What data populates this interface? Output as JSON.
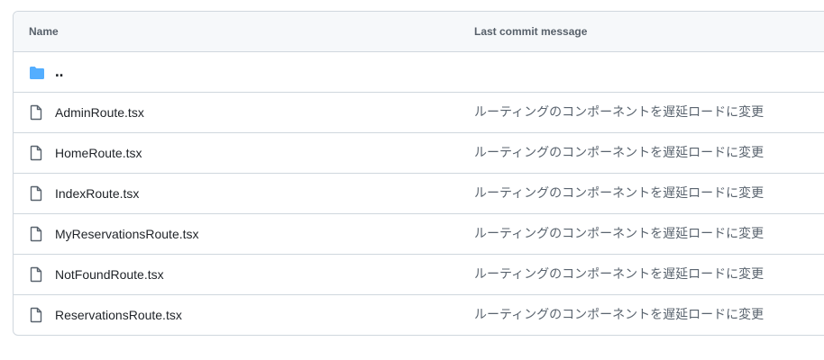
{
  "table": {
    "header": {
      "name_label": "Name",
      "message_label": "Last commit message"
    },
    "parent_dir": {
      "label": "‥",
      "icon": "folder-icon"
    },
    "files": [
      {
        "name": "AdminRoute.tsx",
        "message": "ルーティングのコンポーネントを遅延ロードに変更",
        "icon": "file-icon"
      },
      {
        "name": "HomeRoute.tsx",
        "message": "ルーティングのコンポーネントを遅延ロードに変更",
        "icon": "file-icon"
      },
      {
        "name": "IndexRoute.tsx",
        "message": "ルーティングのコンポーネントを遅延ロードに変更",
        "icon": "file-icon"
      },
      {
        "name": "MyReservationsRoute.tsx",
        "message": "ルーティングのコンポーネントを遅延ロードに変更",
        "icon": "file-icon"
      },
      {
        "name": "NotFoundRoute.tsx",
        "message": "ルーティングのコンポーネントを遅延ロードに変更",
        "icon": "file-icon"
      },
      {
        "name": "ReservationsRoute.tsx",
        "message": "ルーティングのコンポーネントを遅延ロードに変更",
        "icon": "file-icon"
      }
    ],
    "colors": {
      "folder": "#54aeff",
      "file_icon": "#59636e",
      "border": "#d0d7de",
      "header_bg": "#f6f8fa"
    }
  }
}
